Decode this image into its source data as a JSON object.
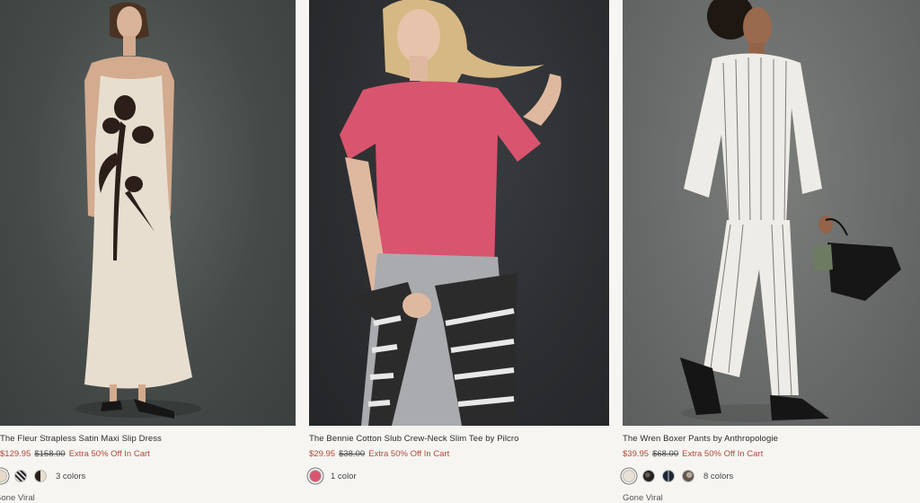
{
  "products": [
    {
      "title": "The Fleur Strapless Satin Maxi Slip Dress",
      "sale_price": "$129.95",
      "original_price": "$158.00",
      "promo": "Extra 50% Off In Cart",
      "colors_label": "3 colors",
      "badge": "Gone Viral",
      "swatch_icons": [
        "ivory-swatch",
        "black-stripe-swatch",
        "floral-swatch"
      ]
    },
    {
      "title": "The Bennie Cotton Slub Crew-Neck Slim Tee by Pilcro",
      "sale_price": "$29.95",
      "original_price": "$38.00",
      "promo": "Extra 50% Off In Cart",
      "colors_label": "1 color",
      "swatch_icons": [
        "pink-swatch"
      ]
    },
    {
      "title": "The Wren Boxer Pants by Anthropologie",
      "sale_price": "$39.95",
      "original_price": "$68.00",
      "promo": "Extra 50% Off In Cart",
      "colors_label": "8 colors",
      "badge": "Gone Viral",
      "swatch_icons": [
        "cream-swatch",
        "dark-print-swatch",
        "navy-swatch",
        "taupe-print-swatch"
      ]
    }
  ],
  "colors": {
    "sale_red": "#b2483a",
    "tee_pink": "#d9546f",
    "page_bg": "#f6f5f1"
  }
}
